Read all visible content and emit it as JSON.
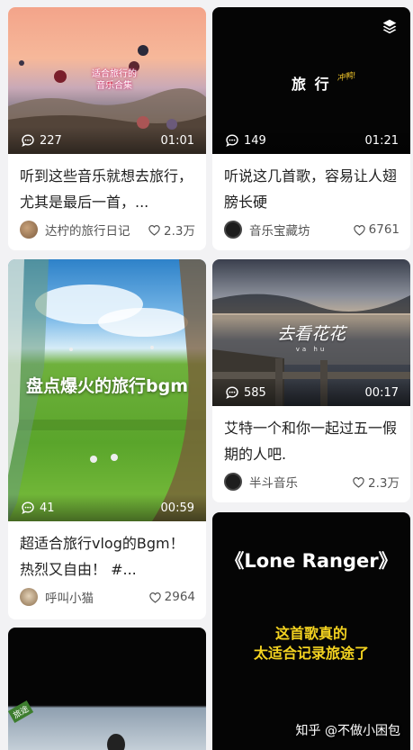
{
  "cards": [
    {
      "overlay": "适合旅行的\n音乐合集",
      "comments": "227",
      "duration": "01:01",
      "title": "听到这些音乐就想去旅行，尤其是最后一首，...",
      "author": "达柠的旅行日记",
      "likes": "2.3万"
    },
    {
      "overlay": "旅 行",
      "overlay_tag": "冲鸭!",
      "comments": "149",
      "duration": "01:21",
      "title": "听说这几首歌，容易让人翅膀长硬",
      "author": "音乐宝藏坊",
      "likes": "6761"
    },
    {
      "overlay": "盘点爆火的旅行bgm",
      "comments": "41",
      "duration": "00:59",
      "title": "超适合旅行vlog的Bgm！热烈又自由！ #...",
      "author": "呼叫小猫",
      "likes": "2964"
    },
    {
      "overlay": "去看花花",
      "overlay_sub": "va hu",
      "comments": "585",
      "duration": "00:17",
      "title": "艾特一个和你一起过五一假期的人吧.",
      "author": "半斗音乐",
      "likes": "2.3万"
    },
    {
      "overlay": "《Lone Ranger》",
      "overlay_sub": "这首歌真的\n太适合记录旅途了"
    },
    {
      "overlay_tag": "旅途"
    }
  ],
  "watermark": "知乎 @不做小困包"
}
